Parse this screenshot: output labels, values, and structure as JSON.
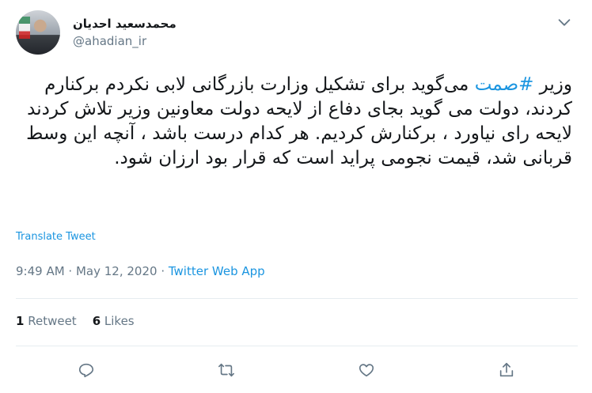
{
  "author": {
    "display_name": "محمدسعید احدیان",
    "handle": "@ahadian_ir"
  },
  "tweet": {
    "hashtag": "#صمت",
    "text_before": "وزیر ",
    "text_after": " می‌گوید برای تشکیل وزارت بازرگانی لابی نکردم برکنارم کردند، دولت می گوید بجای دفاع از لایحه دولت معاونین وزیر تلاش کردند لایحه رای نیاورد ، برکنارش کردیم. هر کدام درست باشد ، آنچه این وسط قربانی شد، قیمت نجومی پراید است که قرار بود ارزان شود.",
    "translate_label": "Translate Tweet"
  },
  "meta": {
    "time": "9:49 AM",
    "dot1": " · ",
    "date": "May 12, 2020",
    "dot2": " · ",
    "source": "Twitter Web App"
  },
  "stats": {
    "retweets_count": "1",
    "retweets_label": "Retweet",
    "likes_count": "6",
    "likes_label": "Likes"
  },
  "icons": {
    "menu": "chevron-down-icon",
    "reply": "reply-icon",
    "retweet": "retweet-icon",
    "like": "heart-icon",
    "share": "share-icon"
  },
  "colors": {
    "accent": "#1b95e0",
    "secondary_text": "#657786",
    "divider": "#e6ecf0"
  }
}
